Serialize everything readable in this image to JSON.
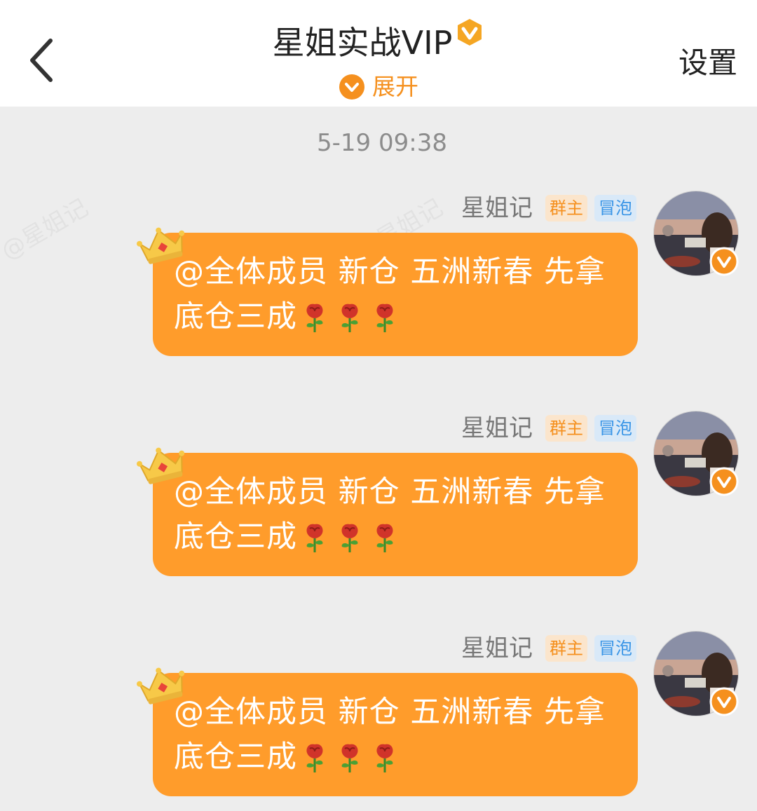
{
  "header": {
    "title": "星姐实战VIP",
    "expand_label": "展开",
    "settings_label": "设置"
  },
  "timestamp": "5-19 09:38",
  "watermark": "@星姐记",
  "messages": [
    {
      "sender": "星姐记",
      "tag_owner": "群主",
      "tag_bubble": "冒泡",
      "text": "@全体成员  新仓 五洲新春 先拿底仓三成"
    },
    {
      "sender": "星姐记",
      "tag_owner": "群主",
      "tag_bubble": "冒泡",
      "text": "@全体成员  新仓 五洲新春 先拿底仓三成"
    },
    {
      "sender": "星姐记",
      "tag_owner": "群主",
      "tag_bubble": "冒泡",
      "text": "@全体成员  新仓 五洲新春 先拿底仓三成"
    }
  ],
  "colors": {
    "accent": "#f5901e",
    "bubble": "#ff9c2b",
    "background": "#ededed"
  },
  "icons": {
    "back": "chevron-left-icon",
    "vip": "vip-v-badge-icon",
    "expand": "chevron-down-circle-icon",
    "crown": "crown-icon",
    "rose": "rose-emoji-icon",
    "verified": "verified-v-icon"
  }
}
